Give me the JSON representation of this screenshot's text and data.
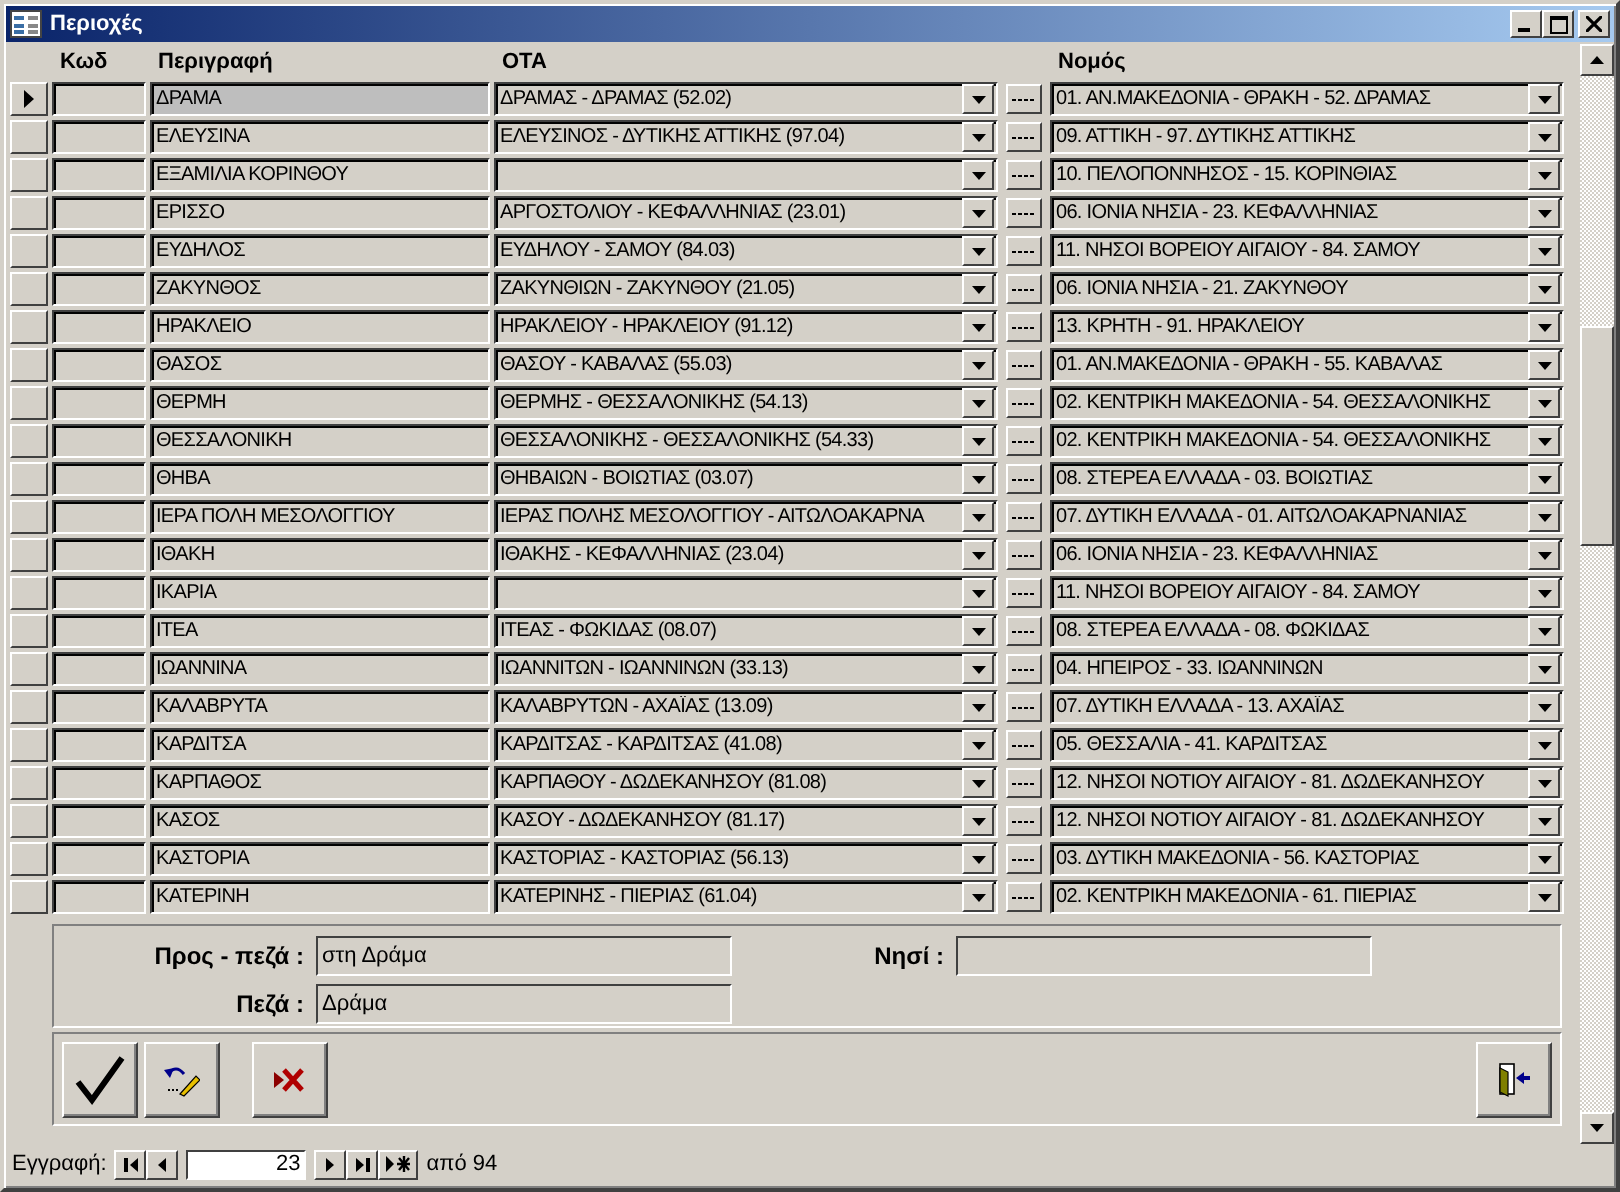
{
  "window": {
    "title": "Περιοχές"
  },
  "table": {
    "columns": [
      "Κωδ",
      "Περιγραφή",
      "ΟΤΑ",
      "Νομός"
    ],
    "rows": [
      {
        "selected": true,
        "description": "ΔΡΑΜΑ",
        "ota": "ΔΡΑΜΑΣ - ΔΡΑΜΑΣ  (52.02)",
        "nomos": "01. ΑΝ.ΜΑΚΕΔΟΝΙΑ - ΘΡΑΚΗ - 52. ΔΡΑΜΑΣ"
      },
      {
        "selected": false,
        "description": "ΕΛΕΥΣΙΝΑ",
        "ota": "ΕΛΕΥΣΙΝΟΣ - ΔΥΤΙΚΗΣ ΑΤΤΙΚΗΣ  (97.04)",
        "nomos": "09. ΑΤΤΙΚΗ - 97. ΔΥΤΙΚΗΣ ΑΤΤΙΚΗΣ"
      },
      {
        "selected": false,
        "description": "ΕΞΑΜΙΛΙΑ ΚΟΡΙΝΘΟΥ",
        "nomos": "10. ΠΕΛΟΠΟΝΝΗΣΟΣ - 15. ΚΟΡΙΝΘΙΑΣ"
      },
      {
        "selected": false,
        "description": "ΕΡΙΣΣΟ",
        "ota": "ΑΡΓΟΣΤΟΛΙΟΥ - ΚΕΦΑΛΛΗΝΙΑΣ  (23.01)",
        "nomos": "06. ΙΟΝΙΑ ΝΗΣΙΑ - 23. ΚΕΦΑΛΛΗΝΙΑΣ"
      },
      {
        "selected": false,
        "description": "ΕΥΔΗΛΟΣ",
        "ota": "ΕΥΔΗΛΟΥ - ΣΑΜΟΥ  (84.03)",
        "nomos": "11. ΝΗΣΟΙ ΒΟΡΕΙΟΥ ΑΙΓΑΙΟΥ - 84. ΣΑΜΟΥ"
      },
      {
        "selected": false,
        "description": "ΖΑΚΥΝΘΟΣ",
        "ota": "ΖΑΚΥΝΘΙΩΝ - ΖΑΚΥΝΘΟΥ  (21.05)",
        "nomos": "06. ΙΟΝΙΑ ΝΗΣΙΑ - 21. ΖΑΚΥΝΘΟΥ"
      },
      {
        "selected": false,
        "description": "ΗΡΑΚΛΕΙΟ",
        "ota": "ΗΡΑΚΛΕΙΟΥ - ΗΡΑΚΛΕΙΟΥ  (91.12)",
        "nomos": "13. ΚΡΗΤΗ - 91. ΗΡΑΚΛΕΙΟΥ"
      },
      {
        "selected": false,
        "description": "ΘΑΣΟΣ",
        "ota": "ΘΑΣΟΥ - ΚΑΒΑΛΑΣ  (55.03)",
        "nomos": "01. ΑΝ.ΜΑΚΕΔΟΝΙΑ - ΘΡΑΚΗ - 55. ΚΑΒΑΛΑΣ"
      },
      {
        "selected": false,
        "description": "ΘΕΡΜΗ",
        "ota": "ΘΕΡΜΗΣ - ΘΕΣΣΑΛΟΝΙΚΗΣ  (54.13)",
        "nomos": "02. ΚΕΝΤΡΙΚΗ ΜΑΚΕΔΟΝΙΑ - 54. ΘΕΣΣΑΛΟΝΙΚΗΣ"
      },
      {
        "selected": false,
        "description": "ΘΕΣΣΑΛΟΝΙΚΗ",
        "ota": "ΘΕΣΣΑΛΟΝΙΚΗΣ - ΘΕΣΣΑΛΟΝΙΚΗΣ  (54.33)",
        "nomos": "02. ΚΕΝΤΡΙΚΗ ΜΑΚΕΔΟΝΙΑ - 54. ΘΕΣΣΑΛΟΝΙΚΗΣ"
      },
      {
        "selected": false,
        "description": "ΘΗΒΑ",
        "ota": "ΘΗΒΑΙΩΝ - ΒΟΙΩΤΙΑΣ  (03.07)",
        "nomos": "08. ΣΤΕΡΕΑ ΕΛΛΑΔΑ - 03. ΒΟΙΩΤΙΑΣ"
      },
      {
        "selected": false,
        "description": "ΙΕΡΑ ΠΟΛΗ ΜΕΣΟΛΟΓΓΙΟΥ",
        "ota": "ΙΕΡΑΣ ΠΟΛΗΣ ΜΕΣΟΛΟΓΓΙΟΥ - ΑΙΤΩΛΟΑΚΑΡΝΑ",
        "nomos": "07. ΔΥΤΙΚΗ ΕΛΛΑΔΑ - 01. ΑΙΤΩΛΟΑΚΑΡΝΑΝΙΑΣ"
      },
      {
        "selected": false,
        "description": "ΙΘΑΚΗ",
        "ota": "ΙΘΑΚΗΣ - ΚΕΦΑΛΛΗΝΙΑΣ  (23.04)",
        "nomos": "06. ΙΟΝΙΑ ΝΗΣΙΑ - 23. ΚΕΦΑΛΛΗΝΙΑΣ"
      },
      {
        "selected": false,
        "description": "ΙΚΑΡΙΑ",
        "nomos": "11. ΝΗΣΟΙ ΒΟΡΕΙΟΥ ΑΙΓΑΙΟΥ - 84. ΣΑΜΟΥ"
      },
      {
        "selected": false,
        "description": "ΙΤΕΑ",
        "ota": "ΙΤΕΑΣ - ΦΩΚΙΔΑΣ  (08.07)",
        "nomos": "08. ΣΤΕΡΕΑ ΕΛΛΑΔΑ - 08. ΦΩΚΙΔΑΣ"
      },
      {
        "selected": false,
        "description": "ΙΩΑΝΝΙΝΑ",
        "ota": "ΙΩΑΝΝΙΤΩΝ - ΙΩΑΝΝΙΝΩΝ  (33.13)",
        "nomos": "04. ΗΠΕΙΡΟΣ - 33. ΙΩΑΝΝΙΝΩΝ"
      },
      {
        "selected": false,
        "description": "ΚΑΛΑΒΡΥΤΑ",
        "ota": "ΚΑΛΑΒΡΥΤΩΝ - ΑΧΑΪΑΣ  (13.09)",
        "nomos": "07. ΔΥΤΙΚΗ ΕΛΛΑΔΑ - 13. ΑΧΑΪΑΣ"
      },
      {
        "selected": false,
        "description": "ΚΑΡΔΙΤΣΑ",
        "ota": "ΚΑΡΔΙΤΣΑΣ - ΚΑΡΔΙΤΣΑΣ  (41.08)",
        "nomos": "05. ΘΕΣΣΑΛΙΑ - 41. ΚΑΡΔΙΤΣΑΣ"
      },
      {
        "selected": false,
        "description": "ΚΑΡΠΑΘΟΣ",
        "ota": "ΚΑΡΠΑΘΟΥ - ΔΩΔΕΚΑΝΗΣΟΥ  (81.08)",
        "nomos": "12. ΝΗΣΟΙ ΝΟΤΙΟΥ ΑΙΓΑΙΟΥ - 81. ΔΩΔΕΚΑΝΗΣΟΥ"
      },
      {
        "selected": false,
        "description": "ΚΑΣΟΣ",
        "ota": "ΚΑΣΟΥ - ΔΩΔΕΚΑΝΗΣΟΥ  (81.17)",
        "nomos": "12. ΝΗΣΟΙ ΝΟΤΙΟΥ ΑΙΓΑΙΟΥ - 81. ΔΩΔΕΚΑΝΗΣΟΥ"
      },
      {
        "selected": false,
        "description": "ΚΑΣΤΟΡΙΑ",
        "ota": "ΚΑΣΤΟΡΙΑΣ - ΚΑΣΤΟΡΙΑΣ  (56.13)",
        "nomos": "03. ΔΥΤΙΚΗ ΜΑΚΕΔΟΝΙΑ - 56. ΚΑΣΤΟΡΙΑΣ"
      },
      {
        "selected": false,
        "description": "ΚΑΤΕΡΙΝΗ",
        "ota": "ΚΑΤΕΡΙΝΗΣ - ΠΙΕΡΙΑΣ  (61.04)",
        "nomos": "02. ΚΕΝΤΡΙΚΗ ΜΑΚΕΔΟΝΙΑ - 61. ΠΙΕΡΙΑΣ"
      }
    ]
  },
  "details": [
    {
      "label": "Προς - πεζά :",
      "value": "στη Δράμα"
    },
    {
      "label": "Πεζά :",
      "value": "Δράμα"
    },
    {
      "label": "Νησί :"
    }
  ],
  "navigation": {
    "label": "Εγγραφή:",
    "record": "23",
    "total": "από 94"
  }
}
